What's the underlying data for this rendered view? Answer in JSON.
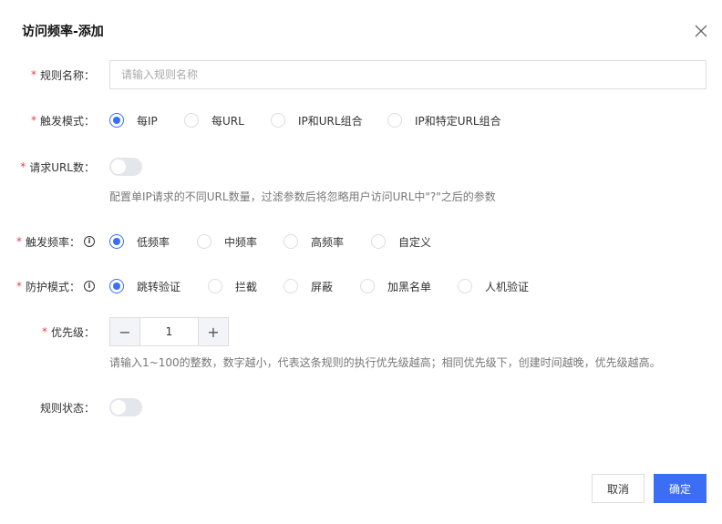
{
  "dialog": {
    "title": "访问频率-添加",
    "close_icon": "close-icon"
  },
  "form": {
    "name": {
      "label": "规则名称：",
      "placeholder": "请输入规则名称",
      "value": ""
    },
    "trigger_mode": {
      "label": "触发模式：",
      "options": [
        "每IP",
        "每URL",
        "IP和URL组合",
        "IP和特定URL组合"
      ],
      "selected": "每IP"
    },
    "url_count": {
      "label": "请求URL数：",
      "enabled": false,
      "help": "配置单IP请求的不同URL数量，过滤参数后将忽略用户访问URL中\"?\"之后的参数"
    },
    "trigger_freq": {
      "label": "触发频率：",
      "options": [
        "低频率",
        "中频率",
        "高频率",
        "自定义"
      ],
      "selected": "低频率"
    },
    "protect_mode": {
      "label": "防护模式：",
      "options": [
        "跳转验证",
        "拦截",
        "屏蔽",
        "加黑名单",
        "人机验证"
      ],
      "selected": "跳转验证"
    },
    "priority": {
      "label": "优先级：",
      "value": "1",
      "minus": "−",
      "plus": "+",
      "help": "请输入1~100的整数，数字越小，代表这条规则的执行优先级越高；相同优先级下，创建时间越晚，优先级越高。"
    },
    "status": {
      "label": "规则状态：",
      "enabled": false
    }
  },
  "footer": {
    "cancel": "取消",
    "confirm": "确定"
  },
  "colors": {
    "primary": "#3b6ef5",
    "required": "#e54545"
  }
}
